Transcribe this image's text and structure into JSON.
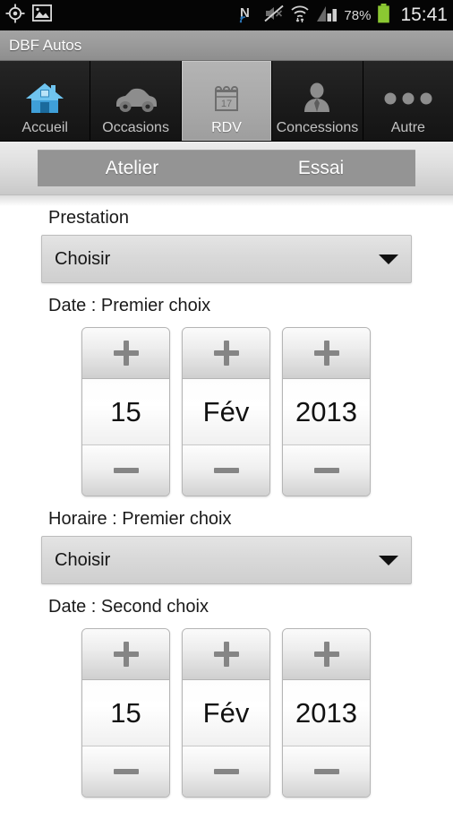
{
  "status_bar": {
    "left_icons": [
      "gps-icon",
      "gallery-icon"
    ],
    "right_icons": [
      "nfc-icon",
      "mute-icon",
      "wifi-icon",
      "signal-icon"
    ],
    "battery_percent": "78%",
    "battery_color": "#8bc832",
    "clock": "15:41"
  },
  "title_bar": {
    "title": "DBF Autos"
  },
  "tabs": [
    {
      "label": "Accueil",
      "icon": "home-icon",
      "selected": false
    },
    {
      "label": "Occasions",
      "icon": "car-icon",
      "selected": false
    },
    {
      "label": "RDV",
      "icon": "calendar-icon",
      "selected": true
    },
    {
      "label": "Concessions",
      "icon": "person-icon",
      "selected": false
    },
    {
      "label": "Autre",
      "icon": "more-dots-icon",
      "selected": false
    }
  ],
  "segmented": {
    "items": [
      {
        "label": "Atelier"
      },
      {
        "label": "Essai"
      }
    ]
  },
  "form": {
    "prestation": {
      "label": "Prestation",
      "select_value": "Choisir"
    },
    "date_premier": {
      "label": "Date : Premier choix",
      "day": "15",
      "month": "Fév",
      "year": "2013",
      "plus_label": "+",
      "minus_label": "−"
    },
    "horaire_premier": {
      "label": "Horaire : Premier choix",
      "select_value": "Choisir"
    },
    "date_second": {
      "label": "Date : Second choix",
      "day": "15",
      "month": "Fév",
      "year": "2013",
      "plus_label": "+",
      "minus_label": "−"
    }
  },
  "colors": {
    "accent_blue": "#49a6e0",
    "tab_selected_bg": "#a8a8a8",
    "title_bar_bg": "#9b9b9b",
    "segmented_bg": "#949494"
  }
}
